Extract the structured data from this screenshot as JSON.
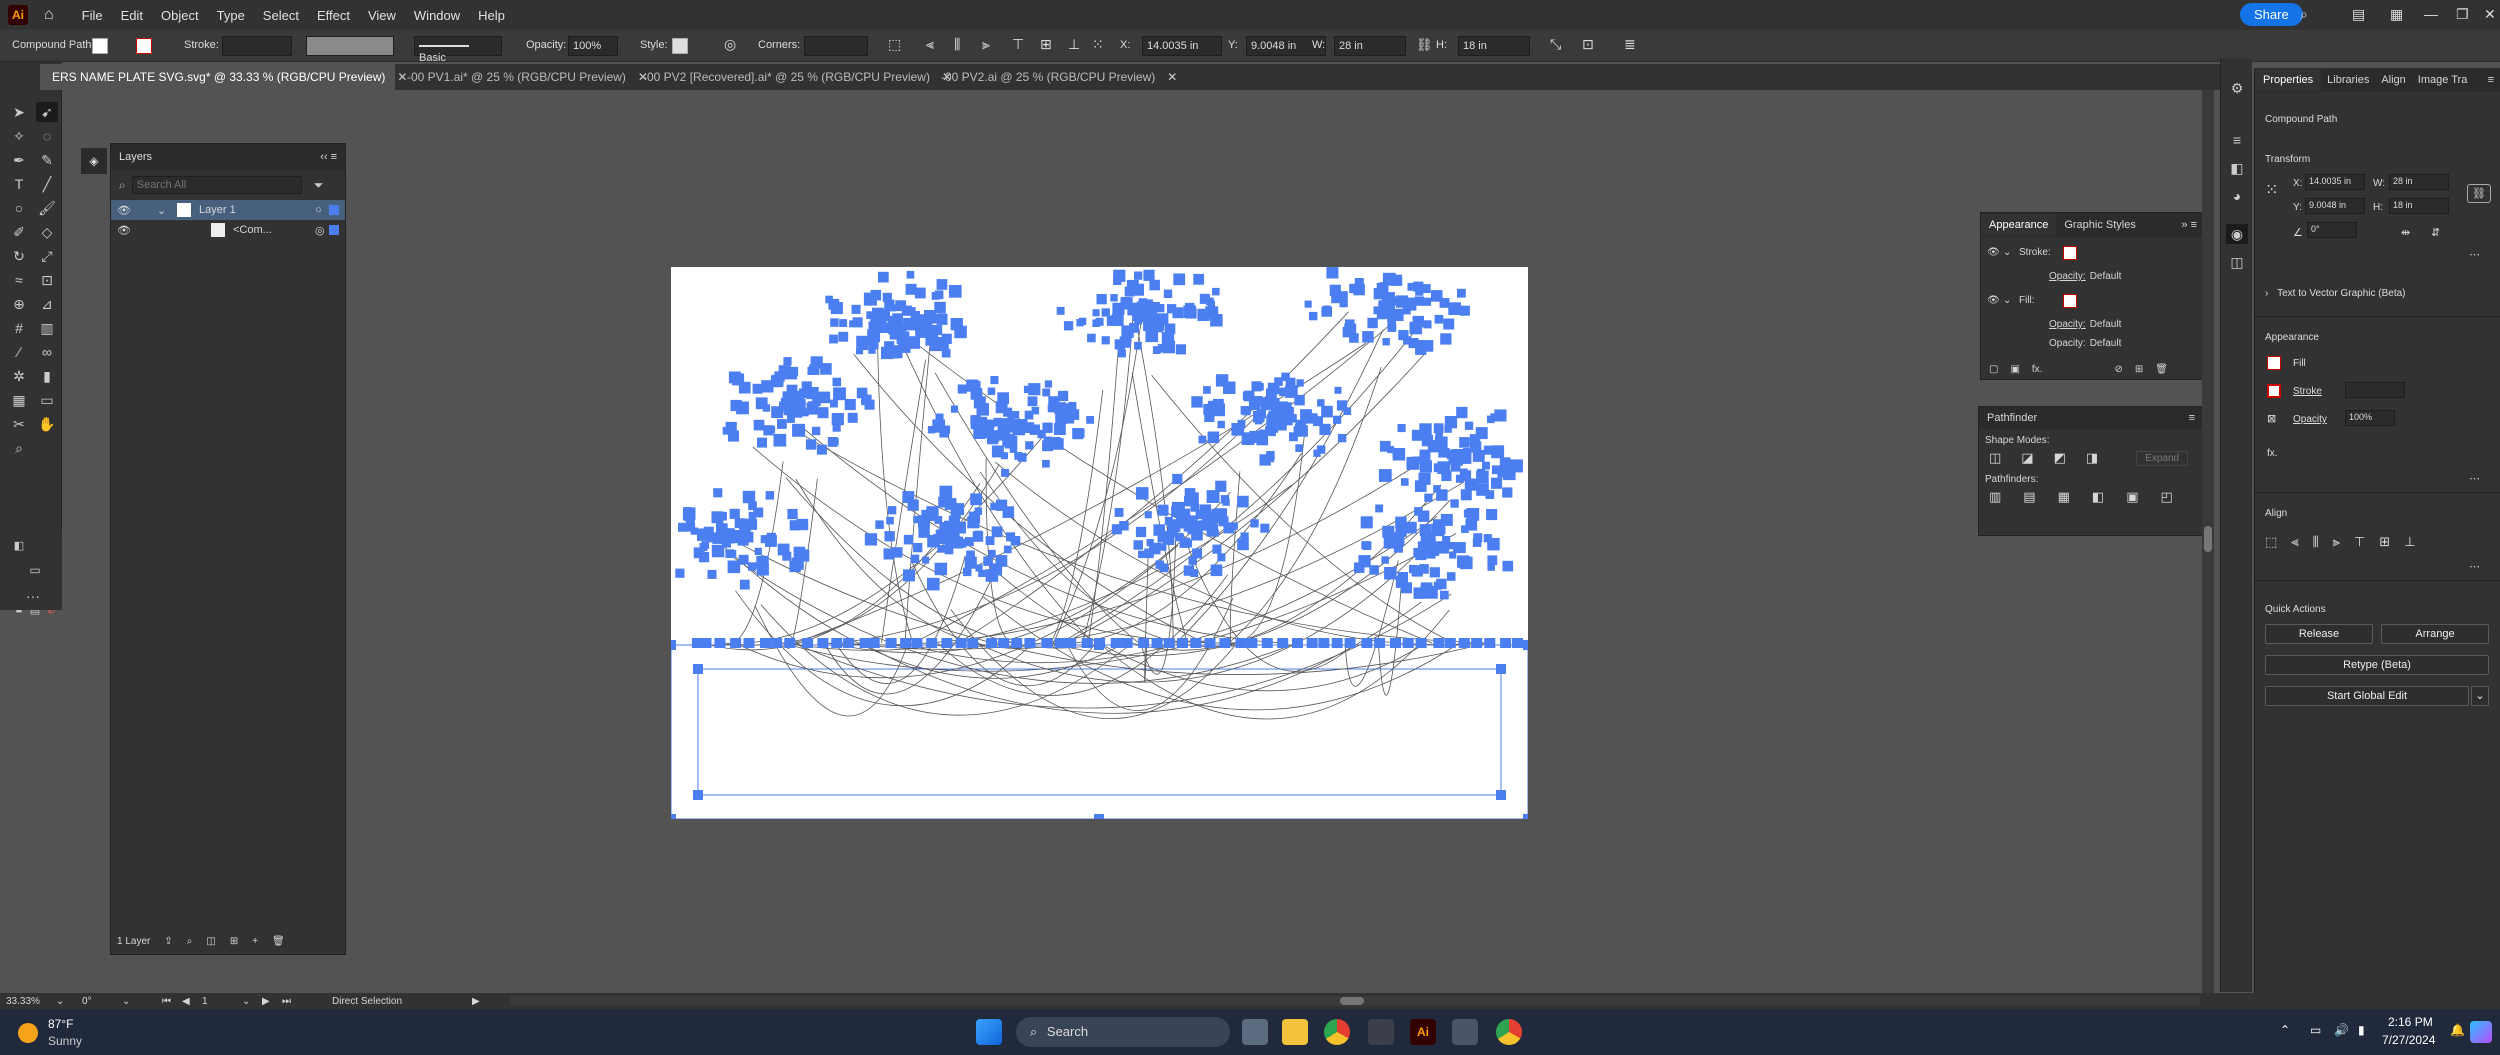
{
  "menubar": {
    "logo": "Ai",
    "menus": [
      "File",
      "Edit",
      "Object",
      "Type",
      "Select",
      "Effect",
      "View",
      "Window",
      "Help"
    ],
    "share": "Share"
  },
  "control": {
    "selection_type": "Compound Path",
    "stroke_label": "Stroke:",
    "brush": "Basic",
    "opacity_label": "Opacity:",
    "opacity_value": "100%",
    "style_label": "Style:",
    "corners_label": "Corners:",
    "x_label": "X:",
    "x_value": "14.0035 in",
    "y_label": "Y:",
    "y_value": "9.0048 in",
    "w_label": "W:",
    "w_value": "28 in",
    "h_label": "H:",
    "h_value": "18 in"
  },
  "tabs": [
    {
      "label": "ERS NAME PLATE SVG.svg* @ 33.33 % (RGB/CPU Preview)",
      "active": true
    },
    {
      "label": "-00 PV1.ai* @ 25 % (RGB/CPU Preview)",
      "active": false
    },
    {
      "label": "-00 PV2 [Recovered].ai* @ 25 % (RGB/CPU Preview)",
      "active": false
    },
    {
      "label": "-00 PV2.ai @ 25 % (RGB/CPU Preview)",
      "active": false
    }
  ],
  "layers": {
    "title": "Layers",
    "search_placeholder": "Search All",
    "rows": [
      {
        "name": "Layer 1"
      },
      {
        "name": "<Com..."
      }
    ],
    "footer": "1 Layer"
  },
  "appearance": {
    "tabs": [
      "Appearance",
      "Graphic Styles"
    ],
    "rows": [
      {
        "label": "Stroke:"
      },
      {
        "label": "Opacity:",
        "value": "Default"
      },
      {
        "label": "Fill:"
      },
      {
        "label": "Opacity:",
        "value": "Default"
      },
      {
        "label": "Opacity:",
        "value": "Default"
      }
    ],
    "fx": "fx."
  },
  "pathfinder": {
    "title": "Pathfinder",
    "shape_modes": "Shape Modes:",
    "expand": "Expand",
    "pathfinders": "Pathfinders:"
  },
  "properties": {
    "tabs": [
      "Properties",
      "Libraries",
      "Align",
      "Image Tra"
    ],
    "object_type": "Compound Path",
    "transform": "Transform",
    "x_label": "X:",
    "x_value": "14.0035 in",
    "y_label": "Y:",
    "y_value": "9.0048 in",
    "w_label": "W:",
    "w_value": "28 in",
    "h_label": "H:",
    "h_value": "18 in",
    "angle": "0°",
    "text_to_vector": "Text to Vector Graphic (Beta)",
    "appearance": "Appearance",
    "fill": "Fill",
    "stroke": "Stroke",
    "opacity_label": "Opacity",
    "opacity_value": "100%",
    "fx": "fx.",
    "align": "Align",
    "quick_actions": "Quick Actions",
    "release": "Release",
    "arrange": "Arrange",
    "retype": "Retype (Beta)",
    "start_global_edit": "Start Global Edit"
  },
  "status": {
    "zoom": "33.33%",
    "rotation": "0°",
    "artboard": "1",
    "tool": "Direct Selection"
  },
  "taskbar": {
    "weather_temp": "87°F",
    "weather_desc": "Sunny",
    "search": "Search",
    "time": "2:16 PM",
    "date": "7/27/2024"
  },
  "colors": {
    "selection": "#4b7ef1",
    "accent": "#1473e6",
    "app_bg": "#535353",
    "panel_bg": "#323232"
  }
}
